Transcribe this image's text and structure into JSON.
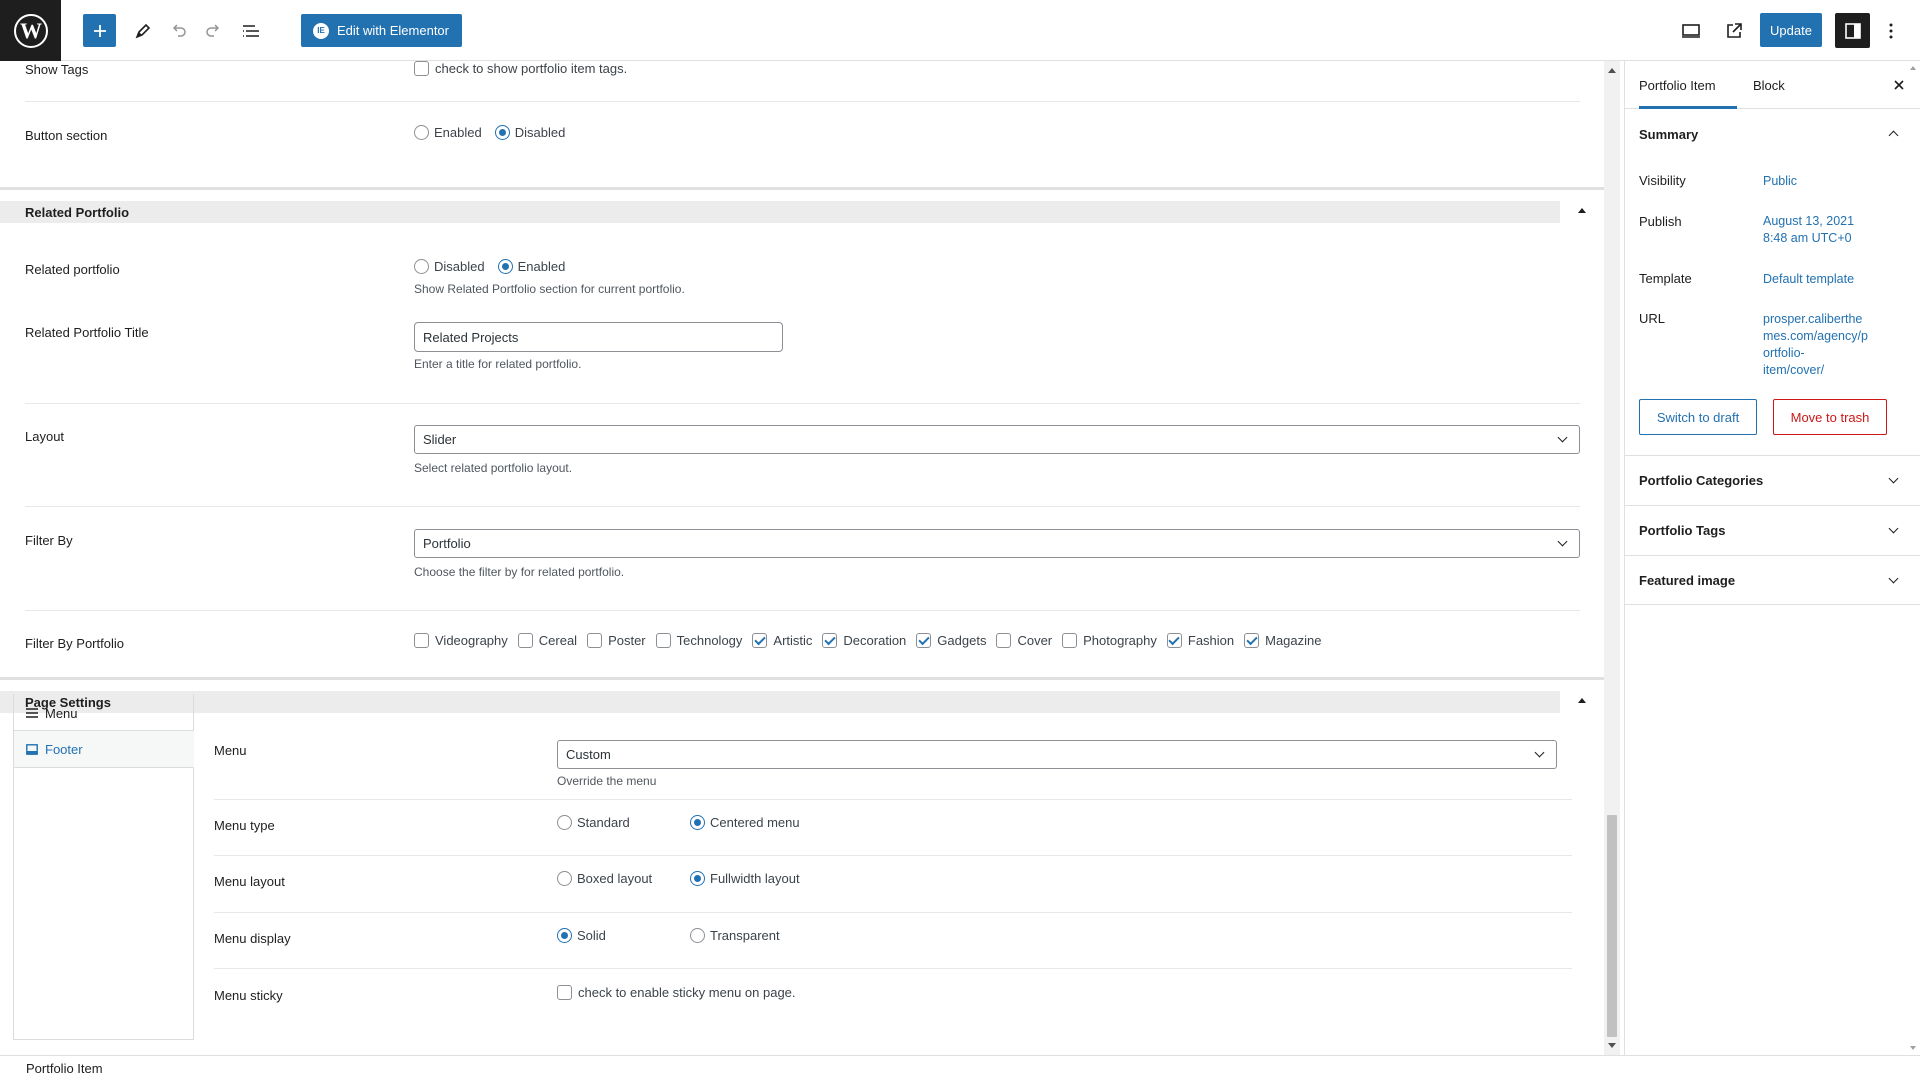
{
  "toolbar": {
    "elementor_label": "Edit with Elementor",
    "update_label": "Update"
  },
  "content": {
    "show_tags": {
      "label": "Show Tags",
      "checkbox_label": "check to show portfolio item tags."
    },
    "button_section": {
      "label": "Button section",
      "options": [
        "Enabled",
        "Disabled"
      ],
      "selected": "Disabled"
    },
    "related_portfolio_section": {
      "title": "Related Portfolio",
      "related_portfolio": {
        "label": "Related portfolio",
        "options": [
          "Disabled",
          "Enabled"
        ],
        "selected": "Enabled",
        "hint": "Show Related Portfolio section for current portfolio."
      },
      "title_field": {
        "label": "Related Portfolio Title",
        "value": "Related Projects",
        "hint": "Enter a title for related portfolio."
      },
      "layout": {
        "label": "Layout",
        "value": "Slider",
        "hint": "Select related portfolio layout."
      },
      "filter_by": {
        "label": "Filter By",
        "value": "Portfolio",
        "hint": "Choose the filter by for related portfolio."
      },
      "filter_by_portfolio": {
        "label": "Filter By Portfolio",
        "items": [
          {
            "label": "Videography",
            "checked": false
          },
          {
            "label": "Cereal",
            "checked": false
          },
          {
            "label": "Poster",
            "checked": false
          },
          {
            "label": "Technology",
            "checked": false
          },
          {
            "label": "Artistic",
            "checked": true
          },
          {
            "label": "Decoration",
            "checked": true
          },
          {
            "label": "Gadgets",
            "checked": true
          },
          {
            "label": "Cover",
            "checked": false
          },
          {
            "label": "Photography",
            "checked": false
          },
          {
            "label": "Fashion",
            "checked": true
          },
          {
            "label": "Magazine",
            "checked": true
          }
        ]
      }
    },
    "page_settings": {
      "title": "Page Settings",
      "tabs": [
        {
          "label": "Menu",
          "icon": "menu-lines-icon"
        },
        {
          "label": "Footer",
          "icon": "footer-icon"
        }
      ],
      "active_tab": "Footer",
      "menu": {
        "label": "Menu",
        "value": "Custom",
        "hint": "Override the menu"
      },
      "menu_type": {
        "label": "Menu type",
        "options": [
          "Standard",
          "Centered menu"
        ],
        "selected": "Centered menu"
      },
      "menu_layout": {
        "label": "Menu layout",
        "options": [
          "Boxed layout",
          "Fullwidth layout"
        ],
        "selected": "Fullwidth layout"
      },
      "menu_display": {
        "label": "Menu display",
        "options": [
          "Solid",
          "Transparent"
        ],
        "selected": "Solid"
      },
      "menu_sticky": {
        "label": "Menu sticky",
        "checkbox_label": "check to enable sticky menu on page."
      }
    }
  },
  "status_bar": {
    "breadcrumb": "Portfolio Item"
  },
  "sidebar": {
    "tabs": [
      "Portfolio Item",
      "Block"
    ],
    "active_tab": "Portfolio Item",
    "summary": {
      "title": "Summary",
      "visibility": {
        "label": "Visibility",
        "value": "Public"
      },
      "publish": {
        "label": "Publish",
        "value_line1": "August 13, 2021",
        "value_line2": "8:48 am UTC+0"
      },
      "template": {
        "label": "Template",
        "value": "Default template"
      },
      "url": {
        "label": "URL",
        "lines": [
          "prosper.caliberthe",
          "mes.com/agency/p",
          "ortfolio-",
          "item/cover/"
        ]
      },
      "switch_to_draft": "Switch to draft",
      "move_to_trash": "Move to trash"
    },
    "panels": [
      "Portfolio Categories",
      "Portfolio Tags",
      "Featured image"
    ]
  },
  "colors": {
    "accent": "#2271b1",
    "danger": "#cc1818",
    "dark": "#1e1e1e"
  }
}
